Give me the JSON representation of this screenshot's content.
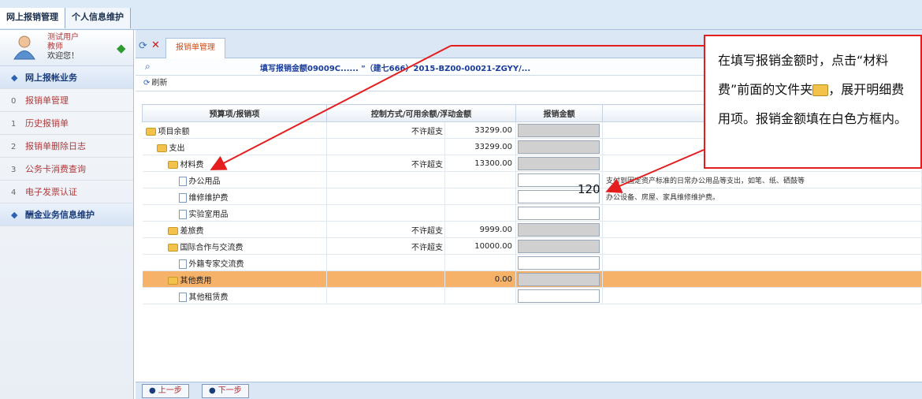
{
  "topbar": {
    "tabs": [
      {
        "label": "网上报销管理"
      },
      {
        "label": "个人信息维护"
      }
    ]
  },
  "user": {
    "name": "测试用户",
    "role": "教师",
    "greeting": "欢迎您！"
  },
  "sidebar": {
    "items": [
      {
        "label": "网上报帐业务",
        "prefix": "◆",
        "section": true
      },
      {
        "label": "报销单管理",
        "prefix": "0"
      },
      {
        "label": "历史报销单",
        "prefix": "1"
      },
      {
        "label": "报销单删除日志",
        "prefix": "2"
      },
      {
        "label": "公务卡消费查询",
        "prefix": "3"
      },
      {
        "label": "电子发票认证",
        "prefix": "4"
      },
      {
        "label": "酬金业务信息维护",
        "prefix": "◆",
        "section": true
      }
    ]
  },
  "page_tab": {
    "label": "报销单管理"
  },
  "info_line": "填写报销金额09009C...... \"（建七666）2015-BZ00-00021-ZGYY/...",
  "refresh_label": "刷新",
  "table": {
    "headers": [
      "预算项/报销项",
      "控制方式/可用余额/浮动金额",
      "",
      "报销金额",
      ""
    ],
    "rows": [
      {
        "indent": 0,
        "icon": "folder",
        "name": "项目余额",
        "control": "不许超支",
        "balance": "33299.00",
        "amount": "",
        "editable": false,
        "note": ""
      },
      {
        "indent": 1,
        "icon": "folder",
        "name": "支出",
        "control": "",
        "balance": "33299.00",
        "amount": "",
        "editable": false,
        "note": ""
      },
      {
        "indent": 2,
        "icon": "folder",
        "name": "材料费",
        "control": "不许超支",
        "balance": "13300.00",
        "amount": "",
        "editable": false,
        "note": ""
      },
      {
        "indent": 3,
        "icon": "doc",
        "name": "办公用品",
        "control": "",
        "balance": "",
        "amount": "",
        "editable": true,
        "note": "支付到固定资产标准的日常办公用品等支出，如笔、纸、硒鼓等"
      },
      {
        "indent": 3,
        "icon": "doc",
        "name": "维修维护费",
        "control": "",
        "balance": "",
        "amount": "",
        "editable": true,
        "note": "办公设备、房屋、家具维修维护费。"
      },
      {
        "indent": 3,
        "icon": "doc",
        "name": "实验室用品",
        "control": "",
        "balance": "",
        "amount": "",
        "editable": true,
        "note": ""
      },
      {
        "indent": 2,
        "icon": "folder",
        "name": "差旅费",
        "control": "不许超支",
        "balance": "9999.00",
        "amount": "",
        "editable": false,
        "note": ""
      },
      {
        "indent": 2,
        "icon": "folder",
        "name": "国际合作与交流费",
        "control": "不许超支",
        "balance": "10000.00",
        "amount": "",
        "editable": false,
        "note": ""
      },
      {
        "indent": 3,
        "icon": "doc",
        "name": "外籍专家交流费",
        "control": "",
        "balance": "",
        "amount": "",
        "editable": true,
        "note": ""
      },
      {
        "indent": 2,
        "icon": "folder",
        "name": "其他费用",
        "control": "",
        "balance": "0.00",
        "amount": "",
        "editable": false,
        "note": "",
        "highlight": true
      },
      {
        "indent": 3,
        "icon": "doc",
        "name": "其他租赁费",
        "control": "",
        "balance": "",
        "amount": "",
        "editable": true,
        "note": ""
      }
    ]
  },
  "typed_amount": "120",
  "footer": {
    "prev": "上一步",
    "next": "下一步"
  },
  "callout": {
    "text_a": "在填写报销金额时，点击“材料费”前面的文件夹",
    "text_b": "，展开明细费用项。报销金额填在白色方框内。"
  },
  "colors": {
    "highlight_row": "#f7b26a",
    "annotation_red": "#e41e1e",
    "locked_cell": "#d0d0d0"
  }
}
